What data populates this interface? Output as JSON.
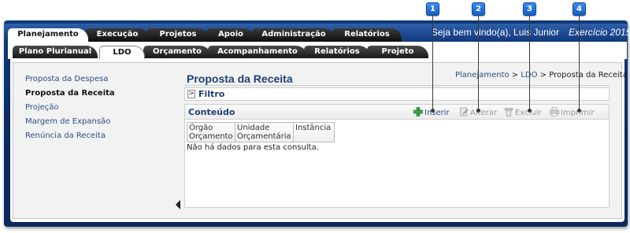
{
  "header": {
    "welcome": "Seja bem vindo(a), Luis Junior",
    "exercicio": "Exercício 2015"
  },
  "main_tabs": [
    {
      "label": "Planejamento",
      "active": true
    },
    {
      "label": "Execução",
      "active": false
    },
    {
      "label": "Projetos",
      "active": false
    },
    {
      "label": "Apoio",
      "active": false
    },
    {
      "label": "Administração",
      "active": false
    },
    {
      "label": "Relatórios",
      "active": false
    }
  ],
  "sub_tabs": [
    {
      "label": "Plano Plurianual",
      "active": false
    },
    {
      "label": "LDO",
      "active": true
    },
    {
      "label": "Orçamento",
      "active": false
    },
    {
      "label": "Acompanhamento",
      "active": false
    },
    {
      "label": "Relatórios",
      "active": false
    },
    {
      "label": "Projeto",
      "active": false
    }
  ],
  "left_menu": [
    {
      "label": "Proposta da Despesa",
      "active": false
    },
    {
      "label": "Proposta da Receita",
      "active": true
    },
    {
      "label": "Projeção",
      "active": false
    },
    {
      "label": "Margem de Expansão",
      "active": false
    },
    {
      "label": "Renúncia da Receita",
      "active": false
    }
  ],
  "page": {
    "title": "Proposta da Receita",
    "breadcrumb": {
      "part1": "Planejamento",
      "sep": " > ",
      "part2": "LDO",
      "part3": "Proposta da Receita"
    }
  },
  "filtro": {
    "toggle": ">",
    "label": "Filtro"
  },
  "conteudo": {
    "title": "Conteúdo",
    "toolbar": [
      {
        "label": "Inserir",
        "icon": "plus-icon",
        "enabled": true
      },
      {
        "label": "Alterar",
        "icon": "edit-icon",
        "enabled": false
      },
      {
        "label": "Excluir",
        "icon": "trash-icon",
        "enabled": false
      },
      {
        "label": "Imprimir",
        "icon": "printer-icon",
        "enabled": false
      }
    ],
    "columns": [
      {
        "line1": "Órgão",
        "line2": "Orçamento"
      },
      {
        "line1": "Unidade",
        "line2": "Orçamentária"
      },
      {
        "line1": "Instância",
        "line2": ""
      }
    ],
    "empty_message": "Não há dados para esta consulta."
  },
  "callouts": [
    "1",
    "2",
    "3",
    "4"
  ],
  "colors": {
    "header_blue": "#0a2a5e",
    "link_blue": "#2b4f87",
    "title_blue": "#1f3f73",
    "callout_blue": "#1f74e0",
    "tab_black": "#111111"
  }
}
